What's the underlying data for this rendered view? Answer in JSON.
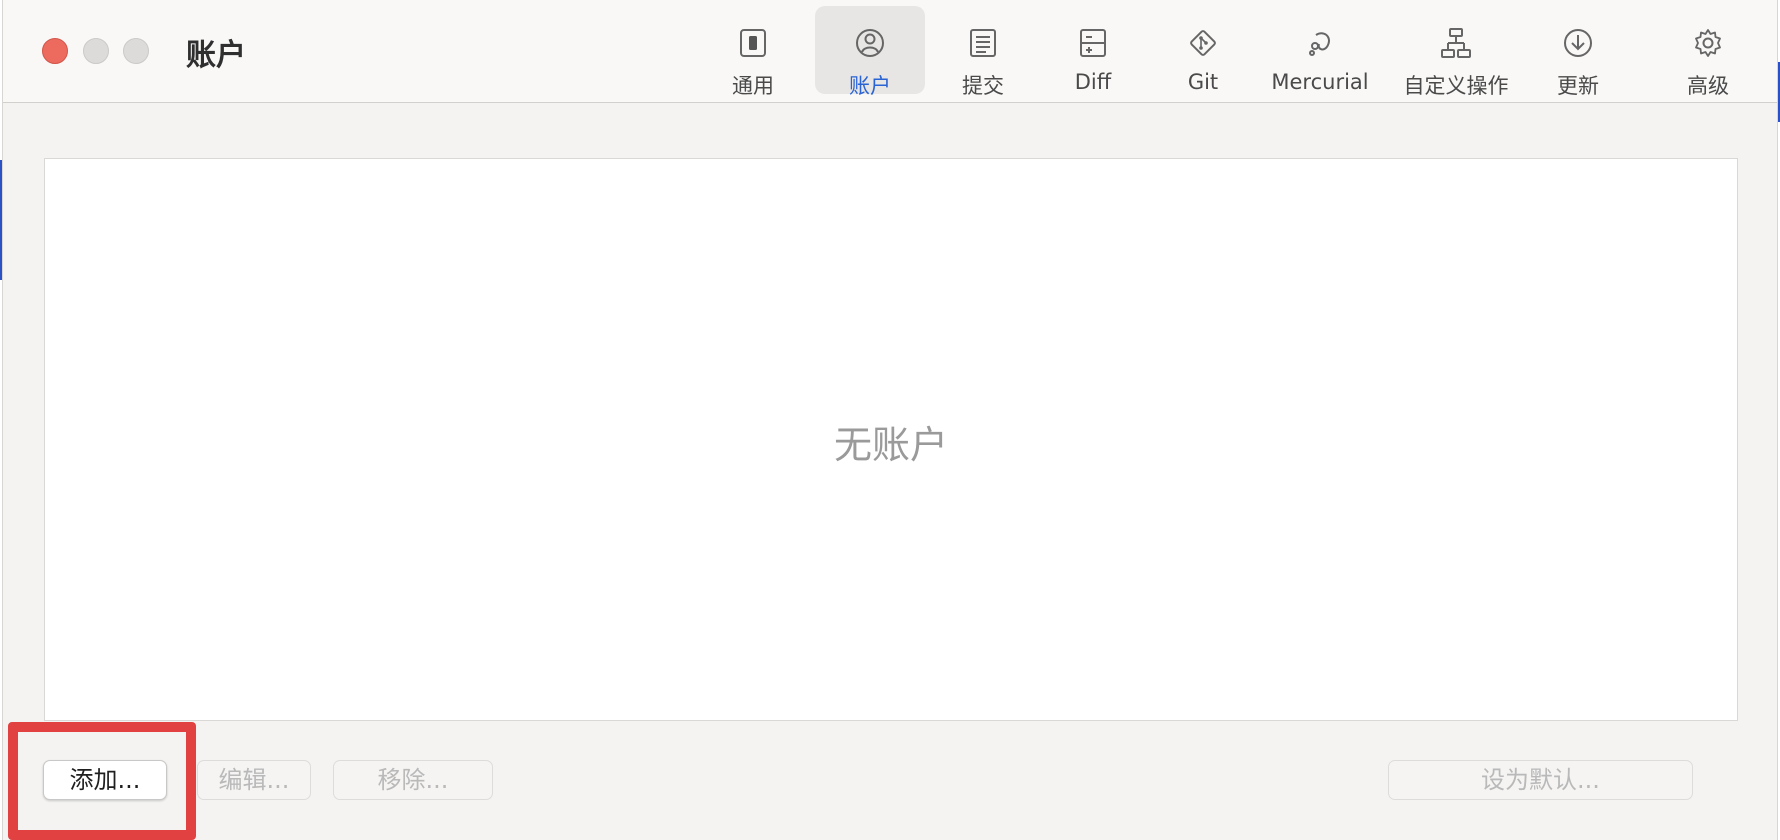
{
  "window": {
    "title": "账户"
  },
  "toolbar": {
    "items": [
      {
        "label": "通用",
        "icon": "general-switch-icon",
        "active": false
      },
      {
        "label": "账户",
        "icon": "account-user-icon",
        "active": true
      },
      {
        "label": "提交",
        "icon": "commit-document-icon",
        "active": false
      },
      {
        "label": "Diff",
        "icon": "diff-icon",
        "active": false
      },
      {
        "label": "Git",
        "icon": "git-icon",
        "active": false
      },
      {
        "label": "Mercurial",
        "icon": "mercurial-icon",
        "active": false
      },
      {
        "label": "自定义操作",
        "icon": "custom-actions-icon",
        "active": false
      },
      {
        "label": "更新",
        "icon": "update-download-icon",
        "active": false
      },
      {
        "label": "高级",
        "icon": "advanced-gear-icon",
        "active": false
      }
    ]
  },
  "accounts": {
    "empty_message": "无账户"
  },
  "buttons": {
    "add": "添加...",
    "edit": "编辑...",
    "remove": "移除...",
    "set_default": "设为默认..."
  },
  "colors": {
    "accent": "#2a63d4",
    "highlight": "#e24141",
    "close": "#ec6a5e"
  }
}
